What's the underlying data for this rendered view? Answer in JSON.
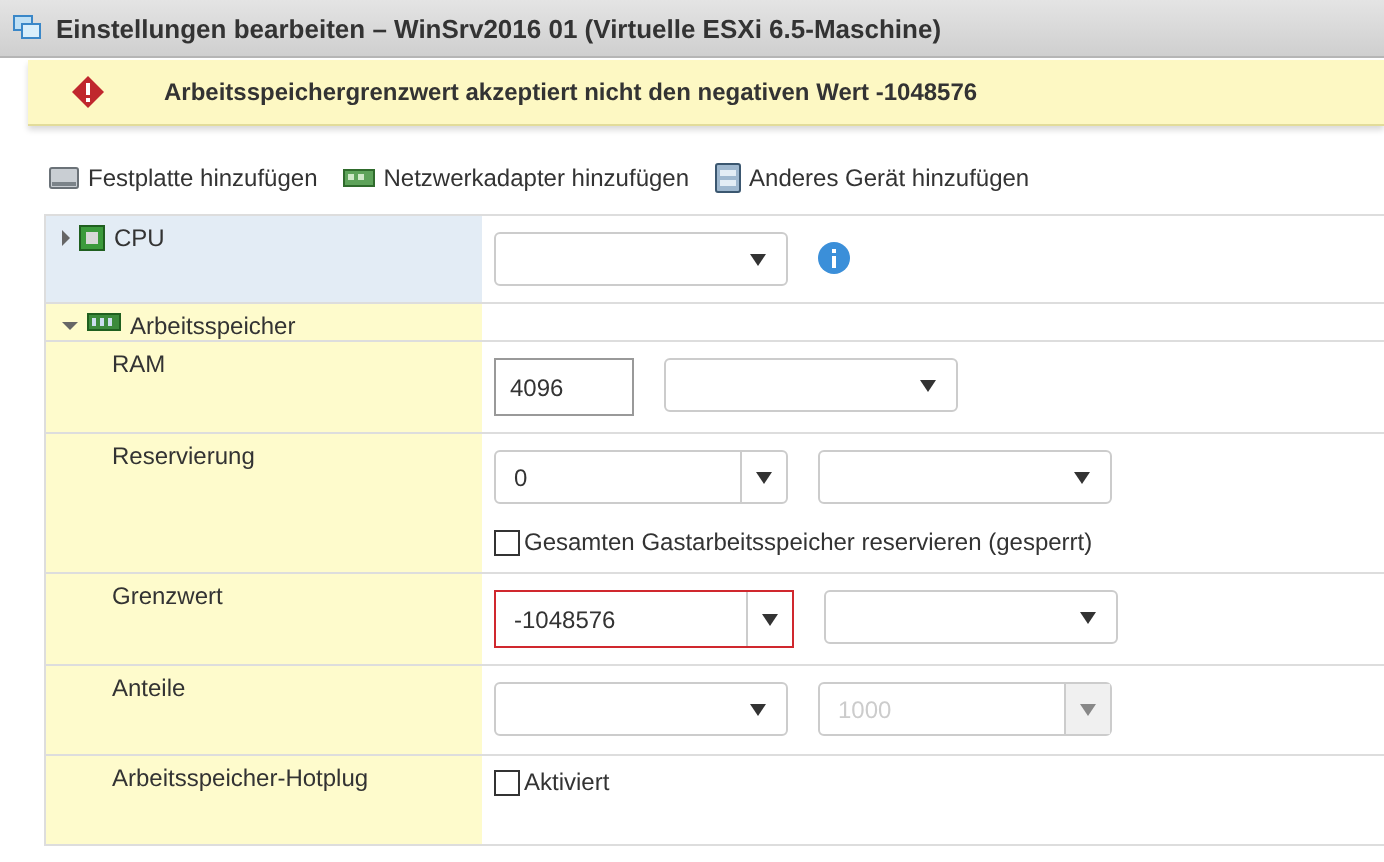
{
  "window": {
    "title": "Einstellungen bearbeiten – WinSrv2016 01 (Virtuelle ESXi 6.5-Maschine)"
  },
  "error_banner": {
    "message": "Arbeitsspeichergrenzwert akzeptiert nicht den negativen Wert -1048576"
  },
  "toolbar": [
    {
      "kind": "disk",
      "label": "Festplatte hinzufügen"
    },
    {
      "kind": "nic",
      "label": "Netzwerkadapter hinzufügen"
    },
    {
      "kind": "device",
      "label": "Anderes Gerät hinzufügen"
    }
  ],
  "rows": [
    {
      "kind": "section",
      "label": "CPU",
      "expanded": false,
      "controls": [
        {
          "kind": "select",
          "disabled": false
        },
        {
          "kind": "info"
        }
      ]
    },
    {
      "kind": "section",
      "label": "Arbeitsspeicher",
      "expanded": true,
      "controls": []
    },
    {
      "kind": "setting",
      "label": "RAM",
      "controls": [
        {
          "kind": "input",
          "value": "4096"
        },
        {
          "kind": "select",
          "disabled": false
        }
      ]
    },
    {
      "kind": "setting",
      "label": "Reservierung",
      "controls": [
        {
          "kind": "combo",
          "value": "0",
          "error": false,
          "disabled": false
        },
        {
          "kind": "select",
          "disabled": false
        },
        {
          "kind": "checkbox",
          "label": "Gesamten Gastarbeitsspeicher reservieren (gesperrt)",
          "checked": false
        }
      ]
    },
    {
      "kind": "setting",
      "label": "Grenzwert",
      "controls": [
        {
          "kind": "combo",
          "value": "-1048576",
          "error": true,
          "disabled": false
        },
        {
          "kind": "select",
          "disabled": false
        }
      ]
    },
    {
      "kind": "setting",
      "label": "Anteile",
      "controls": [
        {
          "kind": "select",
          "disabled": false
        },
        {
          "kind": "combo",
          "value": "1000",
          "error": false,
          "disabled": true
        }
      ]
    },
    {
      "kind": "setting",
      "label": "Arbeitsspeicher-Hotplug",
      "controls": [
        {
          "kind": "checkbox",
          "label": "Aktiviert",
          "checked": false
        }
      ]
    }
  ]
}
